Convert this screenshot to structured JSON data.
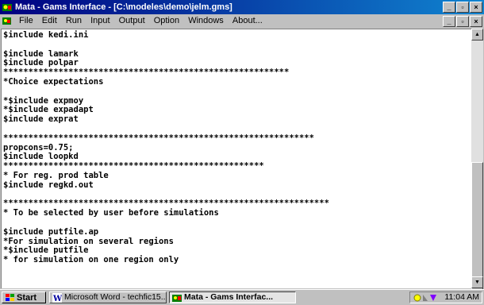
{
  "window": {
    "title": "Mata - Gams Interface - [C:\\modeles\\demo\\jelm.gms]",
    "controls": {
      "minimize": "_",
      "maximize": "▫",
      "close": "×"
    }
  },
  "menubar": {
    "items": [
      "File",
      "Edit",
      "Run",
      "Input",
      "Output",
      "Option",
      "Windows",
      "About..."
    ],
    "controls": {
      "minimize": "_",
      "restore": "▫",
      "close": "×"
    }
  },
  "editor": {
    "lines": [
      "$include kedi.ini",
      "",
      "$include lamark",
      "$include polpar",
      "*********************************************************",
      "*Choice expectations",
      "",
      "*$include expmoy",
      "*$include expadapt",
      "$include exprat",
      "",
      "**************************************************************",
      "propcons=0.75;",
      "$include loopkd",
      "****************************************************",
      "* For reg. prod table",
      "$include regkd.out",
      "",
      "*****************************************************************",
      "* To be selected by user before simulations",
      "",
      "$include putfile.ap",
      "*For simulation on several regions",
      "*$include putfile",
      "* for simulation on one region only"
    ]
  },
  "scrollbar": {
    "up": "▲",
    "down": "▼"
  },
  "taskbar": {
    "start_label": "Start",
    "tasks": [
      {
        "label": "Microsoft Word - techfic15...",
        "active": false
      },
      {
        "label": "Mata - Gams Interfac...",
        "active": true
      }
    ],
    "clock": "11:04 AM"
  },
  "colors": {
    "title_start": "#000080",
    "title_end": "#1084d0",
    "face": "#c0c0c0"
  }
}
